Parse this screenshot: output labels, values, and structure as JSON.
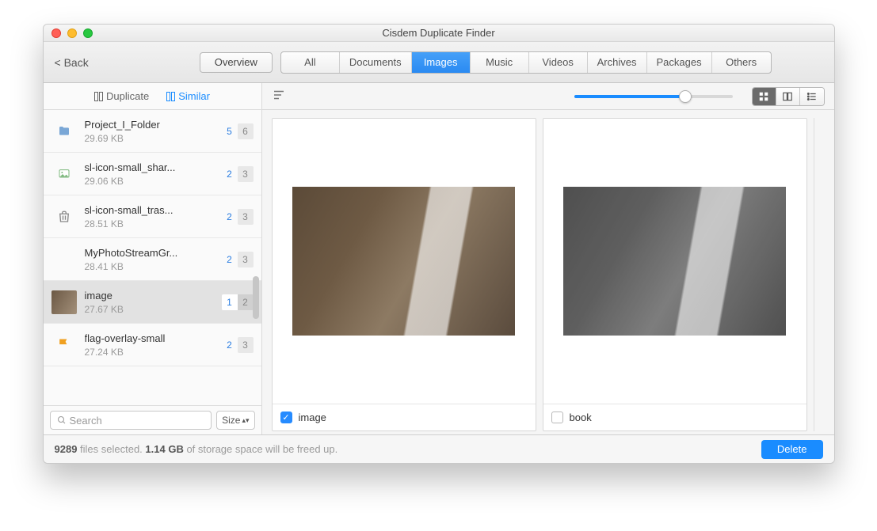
{
  "window": {
    "title": "Cisdem Duplicate Finder"
  },
  "toolbar": {
    "back": "< Back",
    "overview": "Overview",
    "categories": [
      "All",
      "Documents",
      "Images",
      "Music",
      "Videos",
      "Archives",
      "Packages",
      "Others"
    ],
    "active_index": 2
  },
  "sidebar": {
    "tabs": {
      "duplicate": "Duplicate",
      "similar": "Similar",
      "active": "similar"
    },
    "items": [
      {
        "icon": "folder",
        "name": "Project_I_Folder",
        "size": "29.69 KB",
        "blue": "5",
        "gray": "6",
        "selected": false
      },
      {
        "icon": "image",
        "name": "sl-icon-small_shar...",
        "size": "29.06 KB",
        "blue": "2",
        "gray": "3",
        "selected": false
      },
      {
        "icon": "trash",
        "name": "sl-icon-small_tras...",
        "size": "28.51 KB",
        "blue": "2",
        "gray": "3",
        "selected": false
      },
      {
        "icon": "blank",
        "name": "MyPhotoStreamGr...",
        "size": "28.41 KB",
        "blue": "2",
        "gray": "3",
        "selected": false
      },
      {
        "icon": "photo",
        "name": "image",
        "size": "27.67 KB",
        "blue": "1",
        "gray": "2",
        "selected": true
      },
      {
        "icon": "flag",
        "name": "flag-overlay-small",
        "size": "27.24 KB",
        "blue": "2",
        "gray": "3",
        "selected": false
      }
    ],
    "search_placeholder": "Search",
    "size_label": "Size"
  },
  "preview": {
    "left": {
      "label": "image",
      "checked": true
    },
    "right": {
      "label": "book",
      "checked": false
    }
  },
  "footer": {
    "count": "9289",
    "text1": " files selected. ",
    "size": "1.14 GB",
    "text2": " of storage space will be freed up.",
    "delete": "Delete"
  }
}
